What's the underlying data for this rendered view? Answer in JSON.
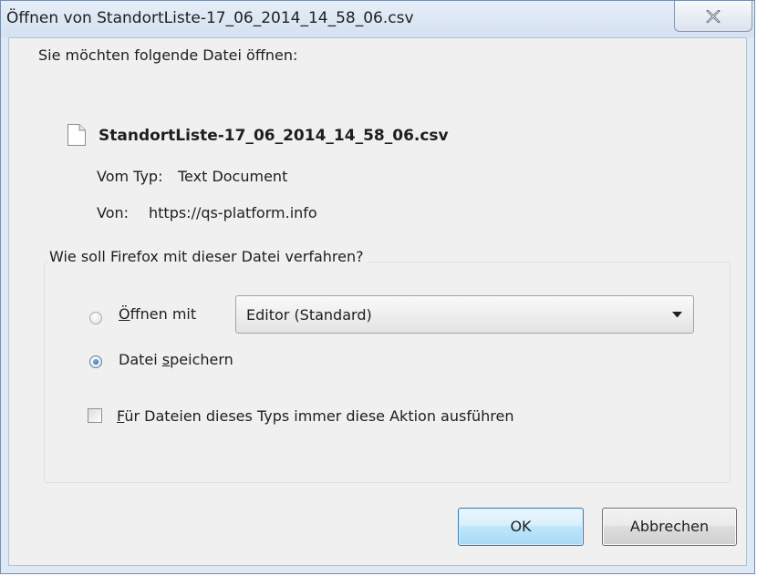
{
  "window": {
    "title": "Öffnen von StandortListe-17_06_2014_14_58_06.csv"
  },
  "intro": "Sie möchten folgende Datei öffnen:",
  "file": {
    "name": "StandortListe-17_06_2014_14_58_06.csv",
    "type_label": "Vom Typ:",
    "type_value": "Text Document",
    "from_label": "Von:",
    "from_value": "https://qs-platform.info"
  },
  "action_group": {
    "legend": "Wie soll Firefox mit dieser Datei verfahren?",
    "open_with": {
      "mnemonic": "Ö",
      "label_rest": "ffnen mit",
      "selected": false
    },
    "app_select": {
      "value": "Editor (Standard)"
    },
    "save_file": {
      "label_pre": "Datei ",
      "mnemonic": "s",
      "label_rest": "peichern",
      "selected": true
    },
    "always_checkbox": {
      "mnemonic": "F",
      "label_rest": "ür Dateien dieses Typs immer diese Aktion ausführen",
      "checked": false
    }
  },
  "buttons": {
    "ok": "OK",
    "cancel": "Abbrechen"
  },
  "icons": {
    "close": "close-icon",
    "file": "document-icon",
    "dropdown": "chevron-down-icon"
  }
}
